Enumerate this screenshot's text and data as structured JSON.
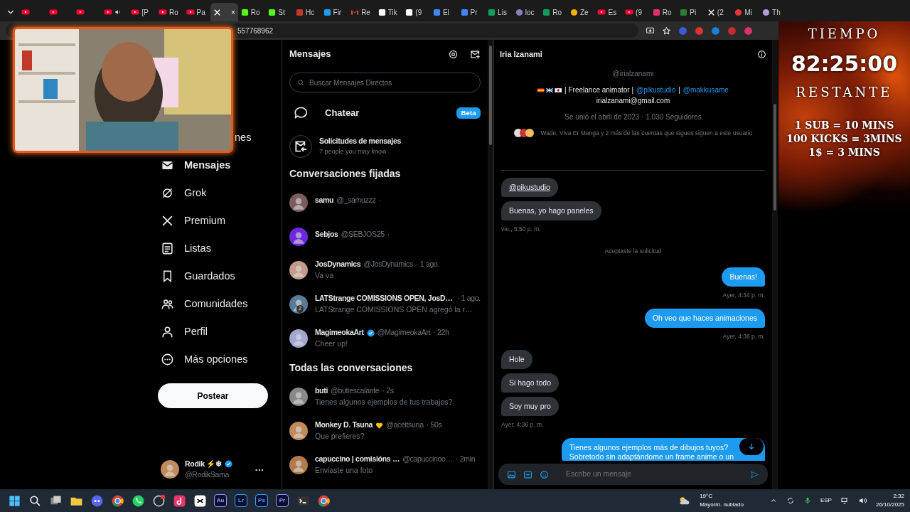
{
  "browser": {
    "tabs": [
      {
        "kind": "video",
        "selected": false
      },
      {
        "kind": "video",
        "selected": false
      },
      {
        "kind": "video",
        "selected": false
      },
      {
        "kind": "video",
        "selected": false,
        "audio": true
      },
      {
        "kind": "video",
        "label": "[P",
        "selected": false
      },
      {
        "kind": "video",
        "label": "Ro",
        "selected": false
      },
      {
        "kind": "video",
        "label": "Pa",
        "selected": false
      },
      {
        "kind": "x",
        "selected": true,
        "close": "×"
      },
      {
        "kind": "square",
        "color": "#53fc18",
        "label": "Ro",
        "selected": false
      },
      {
        "kind": "square",
        "color": "#53fc18",
        "label": "St",
        "selected": false
      },
      {
        "kind": "square",
        "color": "#c0392b",
        "label": "Hc",
        "selected": false
      },
      {
        "kind": "square",
        "color": "#1d9bf0",
        "label": "Fir",
        "selected": false
      },
      {
        "kind": "mail",
        "label": "Re",
        "selected": false
      },
      {
        "kind": "square",
        "color": "#ffffff",
        "label": "Tik",
        "selected": false
      },
      {
        "kind": "square",
        "color": "#ffffff",
        "label": "(9",
        "selected": false
      },
      {
        "kind": "square",
        "color": "#4285f4",
        "label": "El",
        "selected": false
      },
      {
        "kind": "square",
        "color": "#4285f4",
        "label": "Pr",
        "selected": false
      },
      {
        "kind": "square",
        "color": "#0f9d58",
        "label": "Lis",
        "selected": false
      },
      {
        "kind": "circle",
        "color": "#8e7cc3",
        "label": "loc",
        "selected": false
      },
      {
        "kind": "square",
        "color": "#0f9d58",
        "label": "Ro",
        "selected": false
      },
      {
        "kind": "circle",
        "color": "#f4b400",
        "label": "Ze",
        "selected": false
      },
      {
        "kind": "video",
        "label": "Es",
        "selected": false
      },
      {
        "kind": "video",
        "label": "(9",
        "selected": false
      },
      {
        "kind": "square",
        "color": "#e1306c",
        "label": "Ro",
        "selected": false
      },
      {
        "kind": "square",
        "color": "#2e7d32",
        "label": "Pi",
        "selected": false
      },
      {
        "kind": "x",
        "label": "(2",
        "selected": false
      },
      {
        "kind": "circle",
        "color": "#e53935",
        "label": "Mi",
        "selected": false
      },
      {
        "kind": "circle",
        "color": "#b39ddb",
        "label": "Th",
        "selected": false
      }
    ],
    "address": "557768962"
  },
  "sidebar": {
    "items": [
      {
        "kind": "partial",
        "label": "nes",
        "selected": false
      },
      {
        "kind": "mail",
        "label": "Mensajes",
        "selected": true
      },
      {
        "kind": "grok",
        "label": "Grok",
        "selected": false
      },
      {
        "kind": "x",
        "label": "Premium",
        "selected": false
      },
      {
        "kind": "list",
        "label": "Listas",
        "selected": false
      },
      {
        "kind": "bookmark",
        "label": "Guardados",
        "selected": false
      },
      {
        "kind": "people",
        "label": "Comunidades",
        "selected": false
      },
      {
        "kind": "person",
        "label": "Perfil",
        "selected": false
      },
      {
        "kind": "more",
        "label": "Más opciones",
        "selected": false
      }
    ],
    "post_button": "Postear",
    "account": {
      "name": "Rodik ⚡❄",
      "handle": "@RodikSama",
      "more": "···"
    }
  },
  "messages": {
    "title": "Mensajes",
    "search_placeholder": "Buscar Mensajes Directos",
    "chat": {
      "label": "Chatear",
      "badge": "Beta"
    },
    "requests": {
      "title": "Solicitudes de mensajes",
      "subtitle": "7 people you may know"
    },
    "pinned_heading": "Conversaciones fijadas",
    "pinned": [
      {
        "name": "samu",
        "handle": "@_samuzzz",
        "time": "·"
      },
      {
        "name": "Sebjos",
        "handle": "@SEBJOS25",
        "time": "·"
      },
      {
        "name": "JosDynamics",
        "handle": "@JosDynamics",
        "time": "· 1 ago.",
        "preview": "Va va"
      },
      {
        "name": "LATStrange COMISSIONS OPEN, JosD…",
        "time": "· 1 ago.",
        "preview": "LATStrange COMISSIONS OPEN agregó la r…",
        "group_count": "2"
      },
      {
        "name": "MagimeokaArt",
        "verified": true,
        "handle": "@MagimeokaArt",
        "time": "· 22h",
        "preview": "Cheer up!"
      }
    ],
    "all_heading": "Todas las conversaciones",
    "conversations": [
      {
        "name": "buti",
        "handle": "@butiescalante",
        "time": "· 2s",
        "preview": "Tienes algunos ejemplos de tus trabajos?"
      },
      {
        "name": "Monkey D. Tsuna",
        "heart": true,
        "handle": "@aceitsuna",
        "time": "· 50s",
        "preview": "Que prefieres?"
      },
      {
        "name": "capuccino | comisións …",
        "handle": "@capuccinoo…",
        "time": "· 2min",
        "preview": "Enviaste una foto"
      }
    ]
  },
  "chat": {
    "name": "Iria Izanami",
    "handle": "@irialzanami",
    "bio": [
      {
        "kind": "text",
        "text": "| Freelance animator |"
      },
      {
        "kind": "link",
        "text": "@pikustudio"
      },
      {
        "kind": "text",
        "text": "|"
      },
      {
        "kind": "link",
        "text": "@makkusame"
      }
    ],
    "email": "irialzanami@gmail.com",
    "joined": "Se unió el abril de 2023 · 1.030 Seguidores",
    "followed_by": "Wade, Viva Er Manga y 2 más de las cuentas que sigues siguen a este usuario",
    "messages": [
      {
        "kind": "in_link",
        "text": "@pikustudio"
      },
      {
        "kind": "in",
        "text": "Buenas, yo hago paneles"
      },
      {
        "kind": "time_in",
        "text": "vie., 5:50 p. m."
      },
      {
        "kind": "notice",
        "text": "Aceptaste la solicitud"
      },
      {
        "kind": "out",
        "text": "Buenas!"
      },
      {
        "kind": "time_out",
        "text": "Ayer, 4:34 p. m."
      },
      {
        "kind": "out",
        "text": "Oh veo que haces animaciones"
      },
      {
        "kind": "time_out",
        "text": "Ayer, 4:36 p. m."
      },
      {
        "kind": "in",
        "text": "Hole"
      },
      {
        "kind": "in",
        "text": "Si hago todo"
      },
      {
        "kind": "in",
        "text": "Soy muy pro"
      },
      {
        "kind": "time_in",
        "text": "Ayer, 4:36 p. m."
      },
      {
        "kind": "out",
        "text": "Tienes algunos ejemplos más de dibujos tuyos?\nSobretodo sin adaptándome un frame anime o un"
      }
    ],
    "composer_placeholder": "Escribe un mensaje"
  },
  "timer": {
    "title": "TIEMPO",
    "time": "82:25:00",
    "subtitle": "RESTANTE",
    "rules": [
      "1 SUB = 10 MINS",
      "100 KICKS = 3MINS",
      "1$ = 3 MINS"
    ]
  },
  "taskbar": {
    "apps": [
      {
        "kind": "start"
      },
      {
        "kind": "search"
      },
      {
        "kind": "taskview"
      },
      {
        "kind": "folder"
      },
      {
        "kind": "chat"
      },
      {
        "kind": "browser"
      },
      {
        "kind": "phone"
      },
      {
        "kind": "record"
      },
      {
        "kind": "music"
      },
      {
        "kind": "editor"
      },
      {
        "kind": "tile",
        "label": "Au",
        "color": "#9999ff"
      },
      {
        "kind": "tile",
        "label": "Lr",
        "color": "#31a8ff"
      },
      {
        "kind": "tile",
        "label": "Ps",
        "color": "#31a8ff"
      },
      {
        "kind": "tile",
        "label": "Pr",
        "color": "#9999ff"
      },
      {
        "kind": "terminal"
      },
      {
        "kind": "browser"
      }
    ],
    "weather": {
      "temp": "19°C",
      "desc": "Mayorm. nublado"
    },
    "language": "ESP",
    "time": "2:32",
    "date": "26/10/2025"
  }
}
